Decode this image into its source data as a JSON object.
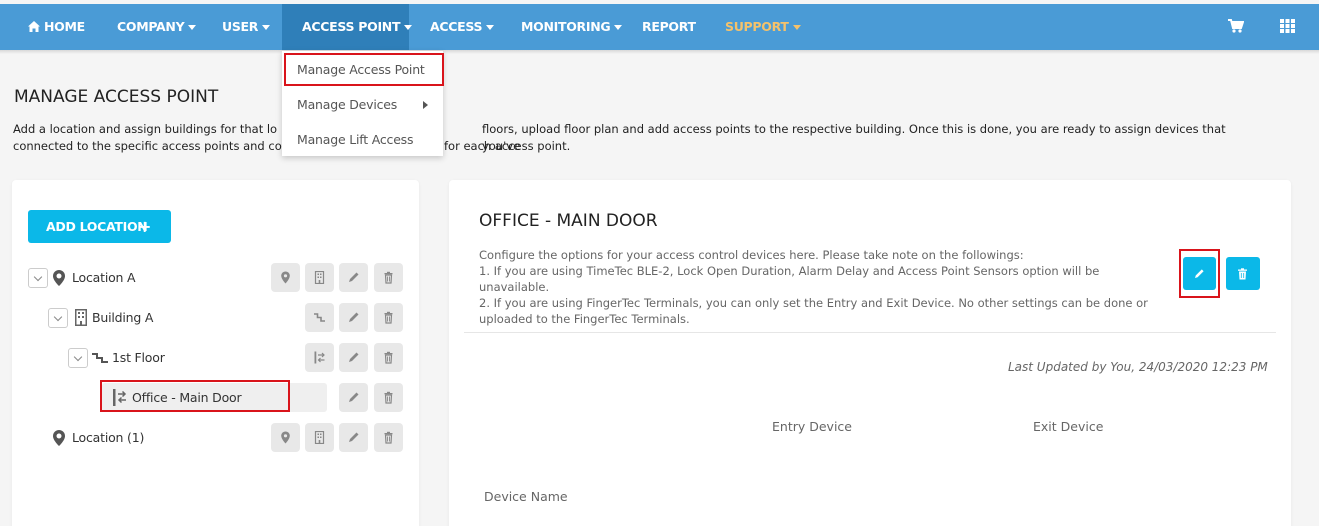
{
  "nav": {
    "home": "HOME",
    "company": "COMPANY",
    "user": "USER",
    "access_point": "ACCESS POINT",
    "access": "ACCESS",
    "monitoring": "MONITORING",
    "report": "REPORT",
    "support": "SUPPORT",
    "cart_icon": "cart-icon",
    "apps_icon": "grid-icon"
  },
  "dropdown": {
    "items": [
      "Manage Access Point",
      "Manage Devices",
      "Manage Lift Access"
    ]
  },
  "page": {
    "title": "MANAGE ACCESS POINT",
    "desc_line1_a": "Add a location and assign buildings for that lo",
    "desc_line1_b": "floors, upload floor plan and add access points to the respective building. Once this is done, you are ready to assign devices that you've",
    "desc_line2_a": "connected to the specific access points and co",
    "desc_line2_b": "for each access point."
  },
  "tree": {
    "add_location": "ADD LOCATION",
    "location_a": "Location A",
    "building_a": "Building A",
    "first_floor": "1st Floor",
    "office_main_door": "Office - Main Door",
    "location_1": "Location (1)"
  },
  "detail": {
    "title": "OFFICE - MAIN DOOR",
    "desc": [
      "Configure the options for your access control devices here. Please take note on the followings:",
      "1. If you are using TimeTec BLE-2, Lock Open Duration, Alarm Delay and Access Point Sensors option will be unavailable.",
      "2. If you are using FingerTec Terminals, you can only set the Entry and Exit Device. No other settings can be done or",
      "uploaded to the FingerTec Terminals."
    ],
    "last_updated": "Last Updated by You, 24/03/2020 12:23 PM",
    "entry_device": "Entry Device",
    "exit_device": "Exit Device",
    "device_name": "Device Name"
  },
  "colors": {
    "navbar": "#4a9bd6",
    "navbar_active": "#2f7fb9",
    "accent": "#0bb8e8",
    "highlight": "#d9141b",
    "support": "#f5c26b"
  }
}
